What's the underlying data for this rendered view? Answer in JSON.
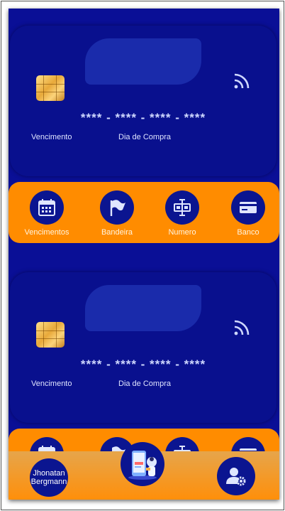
{
  "cards": [
    {
      "number": "**** - **** - **** - ****",
      "vencimento_label": "Vencimento",
      "compra_label": "Dia de Compra"
    },
    {
      "number": "**** - **** - **** - ****",
      "vencimento_label": "Vencimento",
      "compra_label": "Dia de Compra"
    }
  ],
  "options": [
    {
      "label": "Vencimentos",
      "icon": "calendar-icon"
    },
    {
      "label": "Bandeira",
      "icon": "flag-icon"
    },
    {
      "label": "Numero",
      "icon": "text-cursor-icon"
    },
    {
      "label": "Banco",
      "icon": "credit-card-icon"
    }
  ],
  "user": {
    "first": "Jhonatan",
    "last": "Bergmann"
  },
  "colors": {
    "background": "#0a0f96",
    "accent": "#ff8c00",
    "card": "#09108e"
  }
}
